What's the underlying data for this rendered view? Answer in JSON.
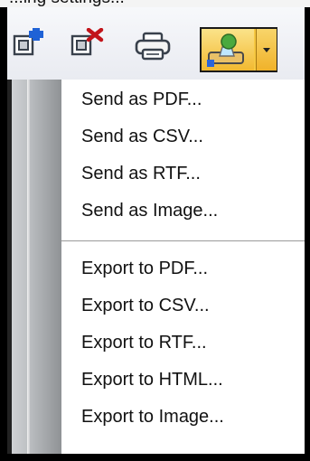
{
  "caption": {
    "text": "...ing settings..."
  },
  "toolbar": {
    "buttons": [
      {
        "icon": "add-icon"
      },
      {
        "icon": "remove-icon"
      },
      {
        "icon": "printer-icon"
      },
      {
        "icon": "send-export-icon",
        "accent": "#f6c842"
      }
    ]
  },
  "menu": {
    "send_items": [
      "Send as PDF...",
      "Send as CSV...",
      "Send as RTF...",
      "Send as Image..."
    ],
    "export_items": [
      "Export to PDF...",
      "Export to CSV...",
      "Export to RTF...",
      "Export to HTML...",
      "Export to Image..."
    ]
  }
}
